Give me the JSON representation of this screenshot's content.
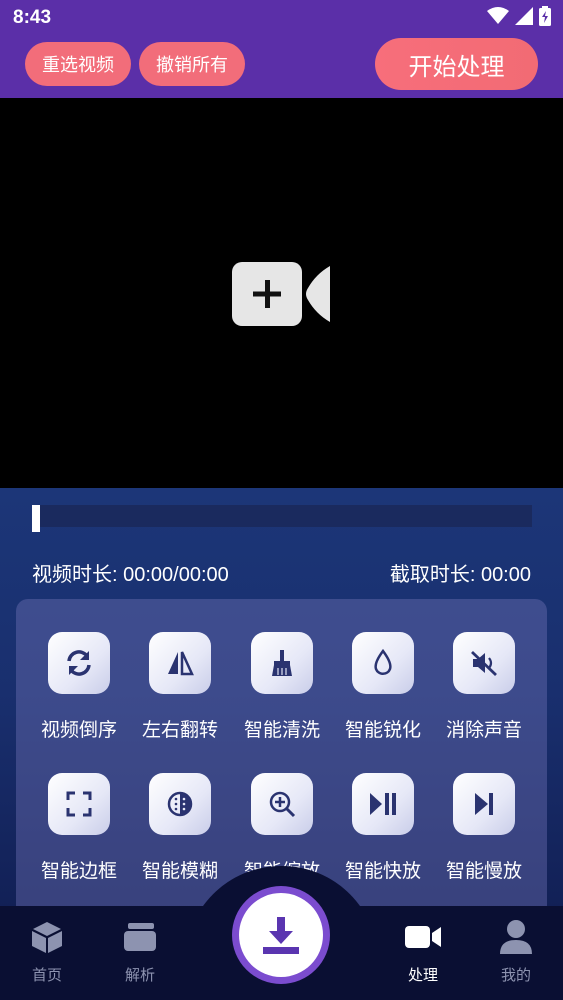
{
  "status_bar": {
    "time": "8:43"
  },
  "header": {
    "reselect_label": "重选视频",
    "undo_label": "撤销所有",
    "start_label": "开始处理"
  },
  "video": {
    "add_icon": "add-video-icon"
  },
  "timeline": {
    "progress": 0,
    "video_duration_label": "视频时长: 00:00/00:00",
    "clip_duration_label": "截取时长: 00:00"
  },
  "tools": [
    {
      "label": "视频倒序",
      "icon": "refresh-icon"
    },
    {
      "label": "左右翻转",
      "icon": "flip-icon"
    },
    {
      "label": "智能清洗",
      "icon": "broom-icon"
    },
    {
      "label": "智能锐化",
      "icon": "drop-icon"
    },
    {
      "label": "消除声音",
      "icon": "mute-icon"
    },
    {
      "label": "智能边框",
      "icon": "frame-icon"
    },
    {
      "label": "智能模糊",
      "icon": "blur-icon"
    },
    {
      "label": "智能缩放",
      "icon": "zoom-in-icon"
    },
    {
      "label": "智能快放",
      "icon": "play-pause-icon"
    },
    {
      "label": "智能慢放",
      "icon": "next-icon"
    }
  ],
  "nav": [
    {
      "label": "首页",
      "icon": "cube-icon",
      "active": false
    },
    {
      "label": "解析",
      "icon": "cards-icon",
      "active": false
    },
    {
      "label": "处理",
      "icon": "video-camera-icon",
      "active": true
    },
    {
      "label": "我的",
      "icon": "user-icon",
      "active": false
    }
  ],
  "colors": {
    "header_bg": "#5b2fa8",
    "pill_bg": "#f26d7a",
    "icon_color": "#2a3370",
    "download_ring": "#7b4ccf"
  }
}
